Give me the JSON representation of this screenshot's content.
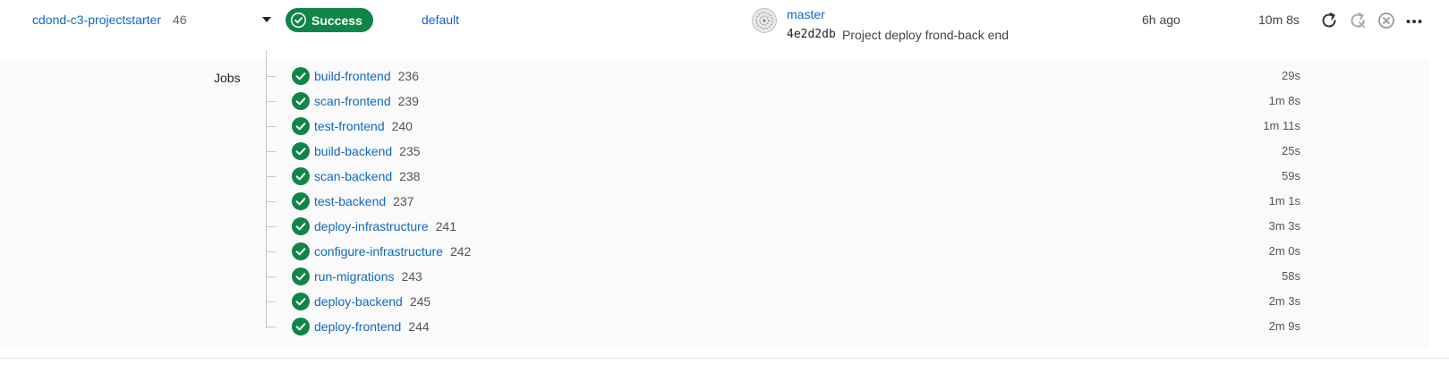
{
  "pipeline": {
    "project": "cdond-c3-projectstarter",
    "id": "46",
    "status": "Success",
    "ref": "default",
    "commit_branch": "master",
    "commit_sha": "4e2d2db",
    "commit_message": "Project deploy frond-back end",
    "time_ago": "6h ago",
    "duration": "10m 8s",
    "status_color": "#108548",
    "link_color": "#1068bf",
    "actions": [
      {
        "icon": "retry-icon",
        "label": "Retry"
      },
      {
        "icon": "rerun-icon",
        "label": "Rerun"
      },
      {
        "icon": "cancel-icon",
        "label": "Cancel"
      },
      {
        "icon": "more-options-icon",
        "label": "More"
      }
    ]
  },
  "jobs": {
    "label": "Jobs",
    "items": [
      {
        "name": "build-frontend",
        "id": "236",
        "duration": "29s"
      },
      {
        "name": "scan-frontend",
        "id": "239",
        "duration": "1m 8s"
      },
      {
        "name": "test-frontend",
        "id": "240",
        "duration": "1m 11s"
      },
      {
        "name": "build-backend",
        "id": "235",
        "duration": "25s"
      },
      {
        "name": "scan-backend",
        "id": "238",
        "duration": "59s"
      },
      {
        "name": "test-backend",
        "id": "237",
        "duration": "1m 1s"
      },
      {
        "name": "deploy-infrastructure",
        "id": "241",
        "duration": "3m 3s"
      },
      {
        "name": "configure-infrastructure",
        "id": "242",
        "duration": "2m 0s"
      },
      {
        "name": "run-migrations",
        "id": "243",
        "duration": "58s"
      },
      {
        "name": "deploy-backend",
        "id": "245",
        "duration": "2m 3s"
      },
      {
        "name": "deploy-frontend",
        "id": "244",
        "duration": "2m 9s"
      }
    ]
  }
}
